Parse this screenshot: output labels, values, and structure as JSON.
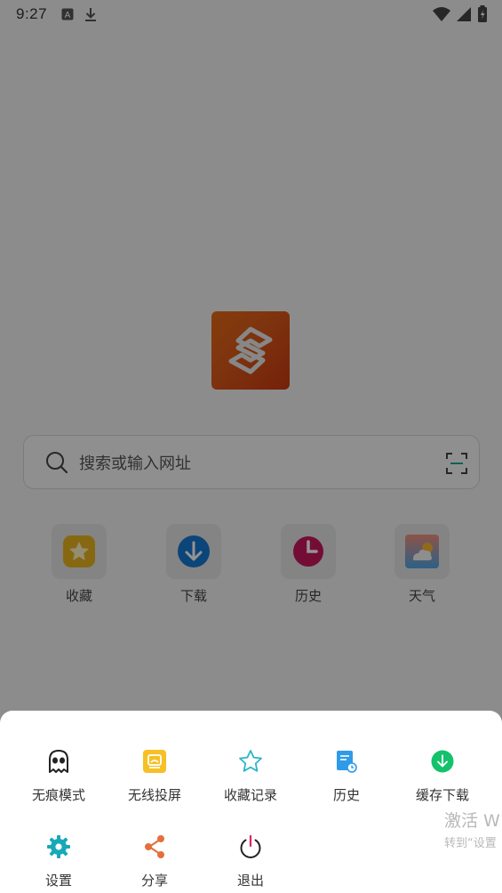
{
  "status_bar": {
    "time": "9:27",
    "left_icons": [
      "a-badge-icon",
      "download-icon"
    ],
    "right_icons": [
      "wifi-icon",
      "signal-icon",
      "battery-icon"
    ]
  },
  "home": {
    "logo_icon": "browser-s-logo-icon",
    "search": {
      "placeholder": "搜索或输入网址"
    },
    "shortcuts": [
      {
        "label": "收藏",
        "icon": "favorites-star-icon",
        "color": "#e8b320"
      },
      {
        "label": "下载",
        "icon": "download-arrow-icon",
        "color": "#1677d2"
      },
      {
        "label": "历史",
        "icon": "history-clock-icon",
        "color": "#c8175d"
      },
      {
        "label": "天气",
        "icon": "weather-icon",
        "color": "#f38f7d"
      }
    ]
  },
  "menu": {
    "items": [
      {
        "label": "无痕模式",
        "icon": "incognito-icon",
        "color": "#222222"
      },
      {
        "label": "无线投屏",
        "icon": "cast-screen-icon",
        "color": "#f6c026"
      },
      {
        "label": "收藏记录",
        "icon": "star-outline-icon",
        "color": "#2bb6c5"
      },
      {
        "label": "历史",
        "icon": "history-doc-icon",
        "color": "#2f9be8"
      },
      {
        "label": "缓存下载",
        "icon": "download-circle-icon",
        "color": "#13c26b"
      },
      {
        "label": "设置",
        "icon": "gear-icon",
        "color": "#17a9b8"
      },
      {
        "label": "分享",
        "icon": "share-icon",
        "color": "#e46f3b"
      },
      {
        "label": "退出",
        "icon": "power-icon",
        "color": "#222222"
      }
    ]
  },
  "watermark": {
    "title": "激活 W",
    "subtitle": "转到“设置"
  }
}
